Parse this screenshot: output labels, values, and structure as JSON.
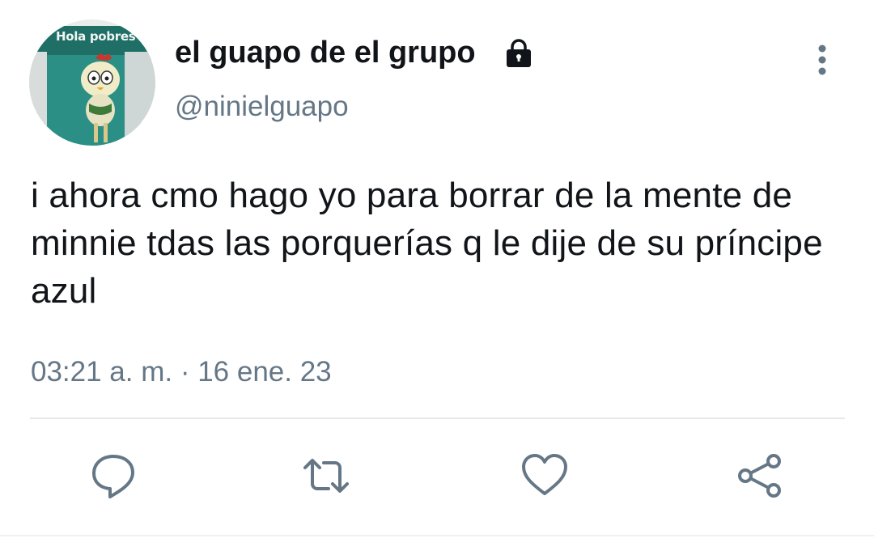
{
  "avatar": {
    "caption": "Hola pobres"
  },
  "user": {
    "display_name": "el guapo de el grupo",
    "handle": "@ninielguapo",
    "protected_icon": "lock-icon"
  },
  "tweet": {
    "text": "i ahora cmo hago yo para borrar de la mente de minnie tdas las porquerías q le dije de su príncipe azul",
    "timestamp": "03:21 a. m. · 16 ene. 23"
  },
  "actions": [
    {
      "name": "reply",
      "icon": "speech-bubble-icon"
    },
    {
      "name": "retweet",
      "icon": "retweet-arrows-icon"
    },
    {
      "name": "like",
      "icon": "heart-outline-icon"
    },
    {
      "name": "share",
      "icon": "share-nodes-icon"
    }
  ],
  "colors": {
    "text_primary": "#111418",
    "text_secondary": "#657786",
    "icon_gray": "#657786",
    "divider": "#e4e8eb"
  }
}
